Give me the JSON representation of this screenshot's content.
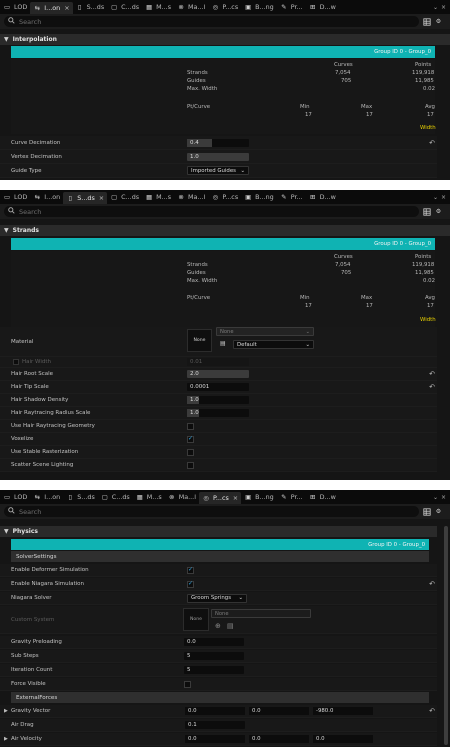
{
  "panel1": {
    "tabs": [
      {
        "icon": "lod-icon",
        "label": "LOD"
      },
      {
        "icon": "interpolation-icon",
        "label": "I...on",
        "active": true,
        "close": "×"
      },
      {
        "icon": "strands-icon",
        "label": "S...ds"
      },
      {
        "icon": "cards-icon",
        "label": "C...ds"
      },
      {
        "icon": "meshes-icon",
        "label": "M...s"
      },
      {
        "icon": "material-icon",
        "label": "Ma...l"
      },
      {
        "icon": "physics-icon",
        "label": "P...cs"
      },
      {
        "icon": "binding-icon",
        "label": "B...ng"
      },
      {
        "icon": "properties-icon",
        "label": "Pr..."
      },
      {
        "icon": "data-icon",
        "label": "D...w"
      }
    ],
    "search_placeholder": "Search",
    "category": "Interpolation",
    "group_label": "Group ID 0 - Group_0",
    "stats": {
      "header_curves": "Curves",
      "header_points": "Points",
      "strands": "Strands",
      "strands_curves": "7,054",
      "strands_points": "119,918",
      "guides": "Guides",
      "guides_curves": "705",
      "guides_points": "11,985",
      "max_width": "Max. Width",
      "max_width_value": "0.02",
      "pt_curve": "Pt/Curve",
      "min": "Min",
      "max": "Max",
      "avg": "Avg",
      "min_value": "17",
      "max_value": "17",
      "avg_value": "17",
      "width": "Width"
    },
    "rows": {
      "curve_decimation": "Curve Decimation",
      "curve_decimation_value": "0.4",
      "curve_decimation_fraction": 0.4,
      "vertex_decimation": "Vertex Decimation",
      "vertex_decimation_value": "1.0",
      "guide_type": "Guide Type",
      "guide_type_value": "Imported Guides"
    }
  },
  "panel2": {
    "tabs": [
      {
        "icon": "lod-icon",
        "label": "LOD"
      },
      {
        "icon": "interpolation-icon",
        "label": "I...on"
      },
      {
        "icon": "strands-icon",
        "label": "S...ds",
        "active": true,
        "close": "×"
      },
      {
        "icon": "cards-icon",
        "label": "C...ds"
      },
      {
        "icon": "meshes-icon",
        "label": "M...s"
      },
      {
        "icon": "material-icon",
        "label": "Ma...l"
      },
      {
        "icon": "physics-icon",
        "label": "P...cs"
      },
      {
        "icon": "binding-icon",
        "label": "B...ng"
      },
      {
        "icon": "properties-icon",
        "label": "Pr..."
      },
      {
        "icon": "data-icon",
        "label": "D...w"
      }
    ],
    "search_placeholder": "Search",
    "category": "Strands",
    "group_label": "Group ID 0 - Group_0",
    "stats": {
      "header_curves": "Curves",
      "header_points": "Points",
      "strands": "Strands",
      "strands_curves": "7,054",
      "strands_points": "119,918",
      "guides": "Guides",
      "guides_curves": "705",
      "guides_points": "11,985",
      "max_width": "Max. Width",
      "max_width_value": "0.02",
      "pt_curve": "Pt/Curve",
      "min": "Min",
      "max": "Max",
      "avg": "Avg",
      "min_value": "17",
      "max_value": "17",
      "avg_value": "17",
      "width": "Width"
    },
    "material": {
      "label": "Material",
      "thumb": "None",
      "asset": "None",
      "slot": "Default"
    },
    "rows": {
      "hair_width": "Hair Width",
      "hair_width_value": "0.01",
      "hair_root_scale": "Hair Root Scale",
      "hair_root_scale_value": "2.0",
      "hair_tip_scale": "Hair Tip Scale",
      "hair_tip_scale_value": "0.0001",
      "hair_shadow_density": "Hair Shadow Density",
      "hair_shadow_density_value": "1.0",
      "hair_rt_radius": "Hair Raytracing Radius Scale",
      "hair_rt_radius_value": "1.0",
      "use_hair_rt_geometry": "Use Hair Raytracing Geometry",
      "voxelize": "Voxelize",
      "use_stable_raster": "Use Stable Rasterization",
      "scatter_scene_lighting": "Scatter Scene Lighting"
    }
  },
  "panel3": {
    "tabs": [
      {
        "icon": "lod-icon",
        "label": "LOD"
      },
      {
        "icon": "interpolation-icon",
        "label": "I...on"
      },
      {
        "icon": "strands-icon",
        "label": "S...ds"
      },
      {
        "icon": "cards-icon",
        "label": "C...ds"
      },
      {
        "icon": "meshes-icon",
        "label": "M...s"
      },
      {
        "icon": "material-icon",
        "label": "Ma...l"
      },
      {
        "icon": "physics-icon",
        "label": "P...cs",
        "active": true,
        "close": "×"
      },
      {
        "icon": "binding-icon",
        "label": "B...ng"
      },
      {
        "icon": "properties-icon",
        "label": "Pr..."
      },
      {
        "icon": "data-icon",
        "label": "D...w"
      }
    ],
    "search_placeholder": "Search",
    "category": "Physics",
    "group_label": "Group ID 0 - Group_0",
    "solver_settings": "SolverSettings",
    "rows": {
      "enable_deformer": "Enable Deformer Simulation",
      "enable_niagara": "Enable Niagara Simulation",
      "niagara_solver": "Niagara Solver",
      "niagara_solver_value": "Groom Springs",
      "custom_system": "Custom System",
      "custom_thumb": "None",
      "custom_asset": "None",
      "gravity_preloading": "Gravity Preloading",
      "gravity_preloading_value": "0.0",
      "sub_steps": "Sub Steps",
      "sub_steps_value": "5",
      "iteration_count": "Iteration Count",
      "iteration_count_value": "5",
      "force_visible": "Force Visible"
    },
    "external_forces": "ExternalForces",
    "forces": {
      "gravity_vector": "Gravity Vector",
      "gx": "0.0",
      "gy": "0.0",
      "gz": "-980.0",
      "air_drag": "Air Drag",
      "air_drag_value": "0.1",
      "air_velocity": "Air Velocity",
      "ax": "0.0",
      "ay": "0.0",
      "az": "0.0"
    }
  },
  "colors": {
    "accent": "#0fb3b3",
    "check": "#2fa9e8",
    "width_label": "#e8d000"
  }
}
